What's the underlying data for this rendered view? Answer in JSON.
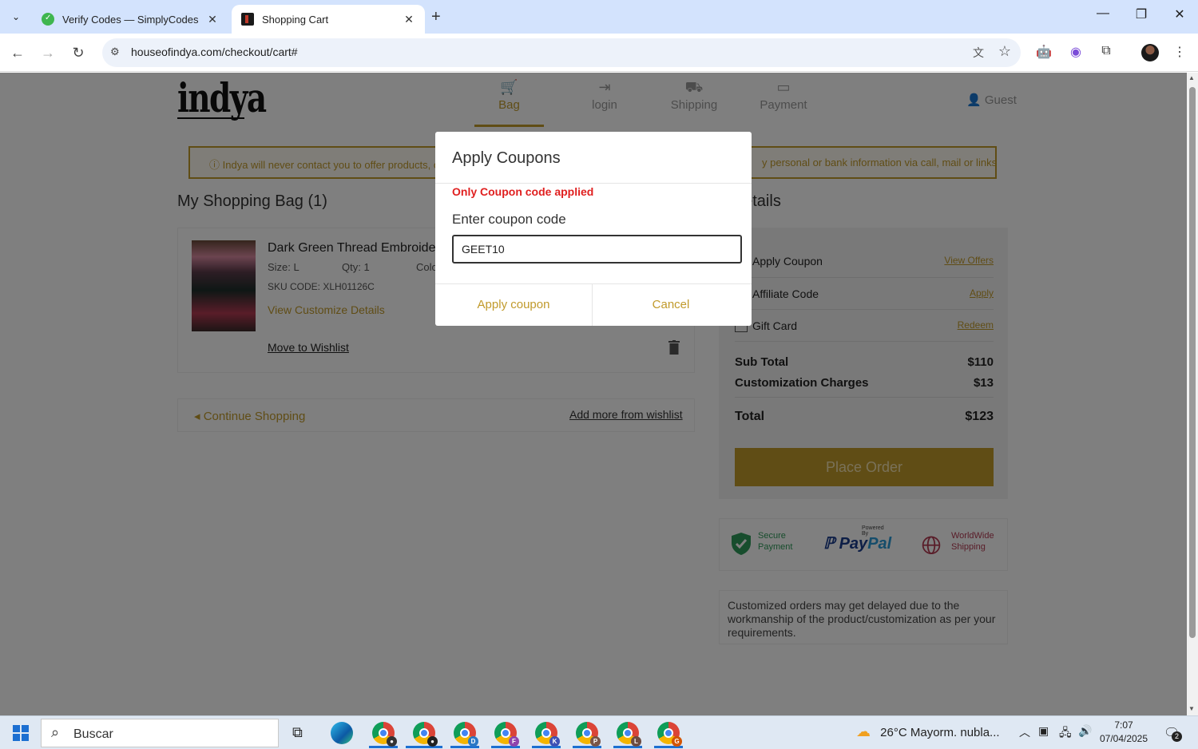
{
  "browser": {
    "tabs": [
      {
        "title": "Verify Codes — SimplyCodes",
        "active": false
      },
      {
        "title": "Shopping Cart",
        "active": true
      }
    ],
    "url": "houseofindya.com/checkout/cart#"
  },
  "site": {
    "logo": "indya",
    "steps": [
      {
        "label": "Bag",
        "icon": "cart-icon",
        "active": true
      },
      {
        "label": "login",
        "icon": "login-icon",
        "active": false
      },
      {
        "label": "Shipping",
        "icon": "truck-icon",
        "active": false
      },
      {
        "label": "Payment",
        "icon": "card-icon",
        "active": false
      }
    ],
    "user_label": "Guest",
    "notice_left": "Indya will never contact you to offer products, ca",
    "notice_right": "y personal or bank information via call, mail or links."
  },
  "bag": {
    "title": "My Shopping Bag (1)",
    "product": {
      "name": "Dark Green Thread Embroidere",
      "size": "Size: L",
      "qty": "Qty: 1",
      "color": "Colo",
      "sku": "SKU CODE: XLH01126C",
      "customize_link": "View Customize Details",
      "wishlist_link": "Move to Wishlist"
    },
    "continue_shopping": "Continue Shopping",
    "add_from_wishlist": "Add more from wishlist"
  },
  "price": {
    "title": "e Details",
    "rows": [
      {
        "label": "Apply Coupon",
        "action": "View Offers"
      },
      {
        "label": "Affiliate Code",
        "action": "Apply"
      },
      {
        "label": "Gift Card",
        "action": "Redeem"
      }
    ],
    "sub_total_label": "Sub Total",
    "sub_total": "$110",
    "custom_label": "Customization Charges",
    "custom": "$13",
    "total_label": "Total",
    "total": "$123",
    "place_order": "Place Order"
  },
  "badges": {
    "secure_1": "Secure",
    "secure_2": "Payment",
    "paypal_powered": "Powered By",
    "paypal_1": "Pay",
    "paypal_2": "Pal",
    "ww_1": "WorldWide",
    "ww_2": "Shipping"
  },
  "note": "Customized orders may get delayed due to the workmanship of the product/customization as per your requirements.",
  "modal": {
    "title": "Apply Coupons",
    "message": "Only Coupon code applied",
    "label": "Enter coupon code",
    "code": "GEET10",
    "apply_label": "Apply coupon",
    "cancel_label": "Cancel"
  },
  "taskbar": {
    "search_placeholder": "Buscar",
    "weather": "26°C  Mayorm. nubla...",
    "time": "7:07",
    "date": "07/04/2025",
    "apps": [
      {
        "name": "chrome-profile-a",
        "badge": ""
      },
      {
        "name": "chrome-profile-active",
        "badge": ""
      },
      {
        "name": "chrome-profile-d",
        "badge": "D"
      },
      {
        "name": "chrome-profile-f",
        "badge": "F"
      },
      {
        "name": "chrome-profile-k",
        "badge": "K"
      },
      {
        "name": "chrome-profile-p",
        "badge": "P"
      },
      {
        "name": "chrome-profile-l",
        "badge": "L"
      },
      {
        "name": "chrome-profile-g",
        "badge": "G"
      }
    ],
    "notifications": "2"
  },
  "colors": {
    "accent": "#c19a2b",
    "error": "#e02020",
    "tabbar": "#d3e3fd"
  }
}
